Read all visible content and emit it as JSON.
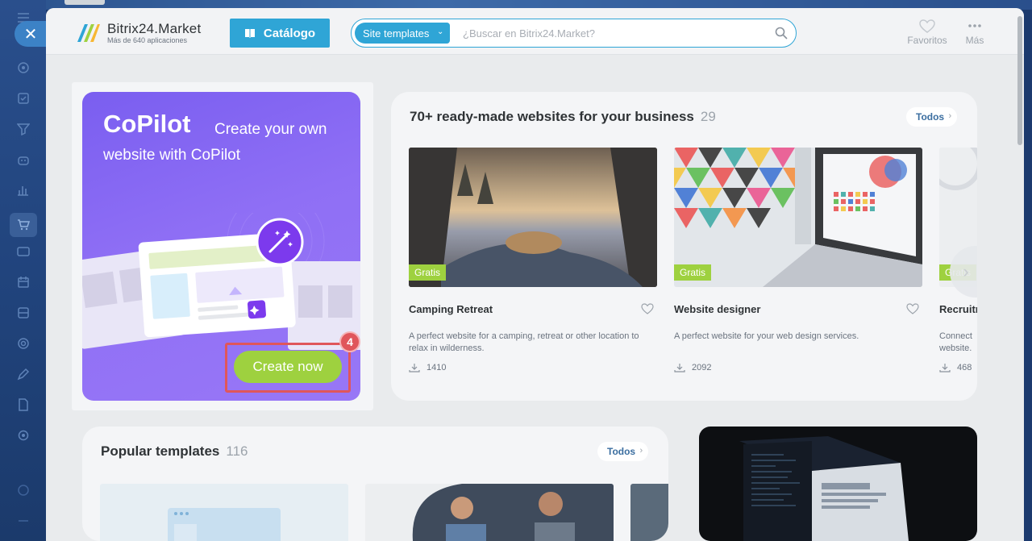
{
  "app": {
    "logo_title": "Bitrix24.Market",
    "logo_subtitle": "Más de 640 aplicaciones",
    "catalog_label": "Catálogo"
  },
  "search": {
    "filter_tag": "Site templates",
    "placeholder": "¿Buscar en Bitrix24.Market?"
  },
  "header_actions": {
    "favorites": "Favoritos",
    "more": "Más"
  },
  "promo": {
    "title": "CoPilot",
    "subtitle_line1": "Create your own",
    "subtitle_line2": "website with CoPilot",
    "button_label": "Create now",
    "step_number": "4"
  },
  "ready_section": {
    "title": "70+ ready-made websites for your business",
    "count": "29",
    "todos_label": "Todos",
    "cards": [
      {
        "badge": "Gratis",
        "name": "Camping Retreat",
        "description": "A perfect website for a camping, retreat or other location to relax in wilderness.",
        "downloads": "1410"
      },
      {
        "badge": "Gratis",
        "name": "Website designer",
        "description": "A perfect website for your web design services.",
        "downloads": "2092"
      },
      {
        "badge": "Gratis",
        "name": "Recruitr",
        "description": "Connect website.",
        "downloads": "468"
      }
    ]
  },
  "popular_section": {
    "title": "Popular templates",
    "count": "116",
    "todos_label": "Todos"
  },
  "colors": {
    "accent_blue": "#2fa5d6",
    "promo_purple": "#8f6ff5",
    "badge_green": "#9ed13f",
    "highlight_red": "#e0565b"
  }
}
